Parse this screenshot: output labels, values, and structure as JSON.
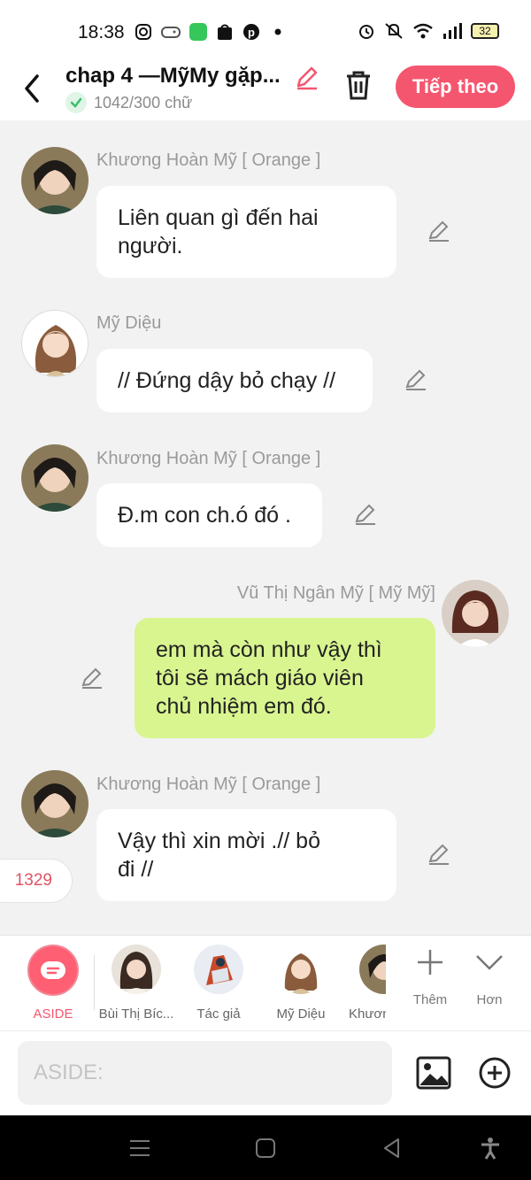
{
  "status_bar": {
    "time": "18:38",
    "battery": "32",
    "icons": [
      "instagram-icon",
      "game-icon",
      "app-icon",
      "shop-icon",
      "pinterest-icon",
      "dot-icon",
      "alarm-icon",
      "mute-icon",
      "wifi-icon",
      "signal-icon",
      "battery-icon"
    ]
  },
  "header": {
    "title": "chap 4 —MỹMy gặp...",
    "word_count": "1042/300 chữ",
    "next_label": "Tiếp theo",
    "accent": "#f5566f"
  },
  "messages": [
    {
      "sender": "Khương Hoàn Mỹ [ Orange ]",
      "lines": [
        "Liên quan gì đến hai",
        "người."
      ],
      "side": "left",
      "avatar": "orange-avatar"
    },
    {
      "sender": "Mỹ Diệu",
      "lines": [
        "// Đứng dậy bỏ chạy //"
      ],
      "side": "left",
      "avatar": "my-dieu-avatar"
    },
    {
      "sender": "Khương Hoàn Mỹ [ Orange ]",
      "lines": [
        "Đ.m con ch.ó đó ."
      ],
      "side": "left",
      "avatar": "orange-avatar"
    },
    {
      "sender": "Vũ Thị Ngân Mỹ [ Mỹ Mỹ]",
      "lines": [
        "em mà còn như vậy thì",
        "tôi sẽ mách giáo viên",
        "chủ nhiệm em đó."
      ],
      "side": "right",
      "avatar": "my-my-avatar"
    },
    {
      "sender": "Khương Hoàn Mỹ [ Orange ]",
      "lines": [
        "Vậy thì xin mời .// bỏ",
        "đi //"
      ],
      "side": "left",
      "avatar": "orange-avatar"
    }
  ],
  "counter": "1329",
  "characters": [
    {
      "label": "ASIDE",
      "active": true
    },
    {
      "label": "Bùi Thị Bíc..."
    },
    {
      "label": "Tác giả"
    },
    {
      "label": "Mỹ Diệu"
    },
    {
      "label": "Khươn"
    }
  ],
  "tools": {
    "add_label": "Thêm",
    "more_label": "Hơn"
  },
  "input": {
    "placeholder": "ASIDE:"
  },
  "colors": {
    "my_bubble": "#d9f590",
    "counter_text": "#e25263"
  }
}
